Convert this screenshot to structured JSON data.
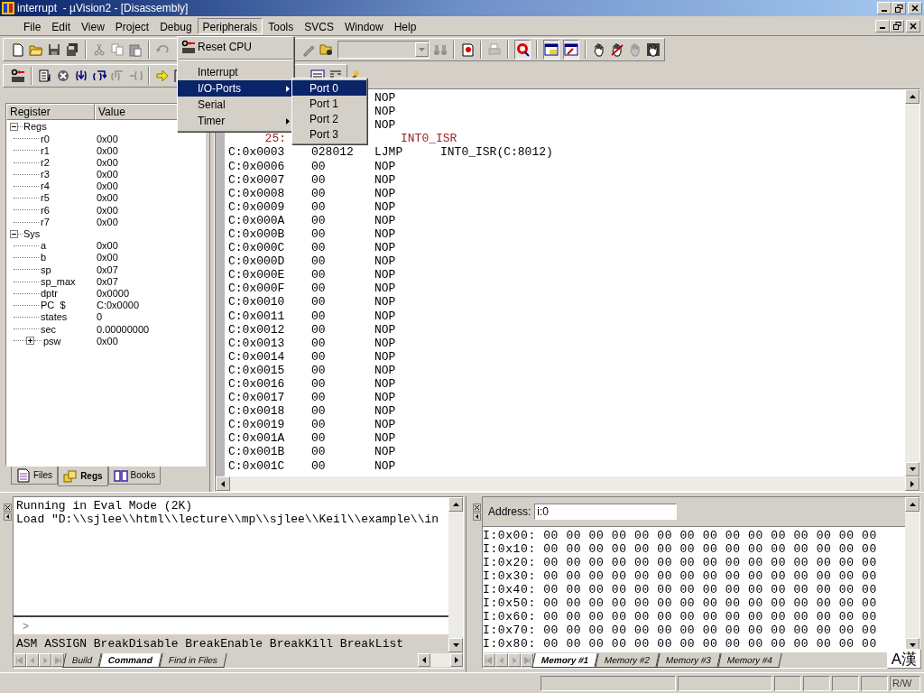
{
  "window": {
    "title": "interrupt  - µVision2 - [Disassembly]"
  },
  "menu_bar": [
    {
      "label": "File",
      "selected": false
    },
    {
      "label": "Edit",
      "selected": false
    },
    {
      "label": "View",
      "selected": false
    },
    {
      "label": "Project",
      "selected": false
    },
    {
      "label": "Debug",
      "selected": false
    },
    {
      "label": "Peripherals",
      "selected": true
    },
    {
      "label": "Tools",
      "selected": false
    },
    {
      "label": "SVCS",
      "selected": false
    },
    {
      "label": "Window",
      "selected": false
    },
    {
      "label": "Help",
      "selected": false
    }
  ],
  "peripherals_menu": {
    "items": [
      {
        "kind": "icon_command",
        "label": "Reset CPU",
        "selected": false
      },
      {
        "kind": "separator"
      },
      {
        "kind": "command",
        "label": "Interrupt",
        "selected": false
      },
      {
        "kind": "submenu",
        "label": "I/O-Ports",
        "selected": true
      },
      {
        "kind": "command",
        "label": "Serial",
        "selected": false
      },
      {
        "kind": "submenu",
        "label": "Timer",
        "selected": false
      }
    ]
  },
  "io_ports_submenu": [
    {
      "label": "Port 0",
      "selected": true
    },
    {
      "label": "Port 1",
      "selected": false
    },
    {
      "label": "Port 2",
      "selected": false
    },
    {
      "label": "Port 3",
      "selected": false
    }
  ],
  "register_panel": {
    "columns": [
      "Register",
      "Value"
    ],
    "tree": [
      {
        "name": "Regs",
        "expanded": true,
        "children": [
          {
            "name": "r0",
            "value": "0x00"
          },
          {
            "name": "r1",
            "value": "0x00"
          },
          {
            "name": "r2",
            "value": "0x00"
          },
          {
            "name": "r3",
            "value": "0x00"
          },
          {
            "name": "r4",
            "value": "0x00"
          },
          {
            "name": "r5",
            "value": "0x00"
          },
          {
            "name": "r6",
            "value": "0x00"
          },
          {
            "name": "r7",
            "value": "0x00"
          }
        ]
      },
      {
        "name": "Sys",
        "expanded": true,
        "children": [
          {
            "name": "a",
            "value": "0x00"
          },
          {
            "name": "b",
            "value": "0x00"
          },
          {
            "name": "sp",
            "value": "0x07"
          },
          {
            "name": "sp_max",
            "value": "0x07"
          },
          {
            "name": "dptr",
            "value": "0x0000"
          },
          {
            "name": "PC  $",
            "value": "C:0x0000"
          },
          {
            "name": "states",
            "value": "0"
          },
          {
            "name": "sec",
            "value": "0.00000000"
          },
          {
            "name": "psw",
            "value": "0x00",
            "expanded": false
          }
        ]
      }
    ],
    "tabs": [
      {
        "label": "Files",
        "selected": false
      },
      {
        "label": "Regs",
        "selected": true
      },
      {
        "label": "Books",
        "selected": false
      }
    ]
  },
  "disassembly": {
    "lines": [
      {
        "kind": "code",
        "mnemonic": "NOP"
      },
      {
        "kind": "code",
        "mnemonic": "NOP"
      },
      {
        "kind": "code",
        "mnemonic": "NOP"
      },
      {
        "kind": "source",
        "line_number": "25:",
        "text": "INT0_ISR"
      },
      {
        "kind": "code",
        "address": "C:0x0003",
        "opcode": "028012",
        "mnemonic": "LJMP",
        "operand": "INT0_ISR(C:8012)"
      },
      {
        "kind": "code",
        "address": "C:0x0006",
        "opcode": "00",
        "mnemonic": "NOP"
      },
      {
        "kind": "code",
        "address": "C:0x0007",
        "opcode": "00",
        "mnemonic": "NOP"
      },
      {
        "kind": "code",
        "address": "C:0x0008",
        "opcode": "00",
        "mnemonic": "NOP"
      },
      {
        "kind": "code",
        "address": "C:0x0009",
        "opcode": "00",
        "mnemonic": "NOP"
      },
      {
        "kind": "code",
        "address": "C:0x000A",
        "opcode": "00",
        "mnemonic": "NOP"
      },
      {
        "kind": "code",
        "address": "C:0x000B",
        "opcode": "00",
        "mnemonic": "NOP"
      },
      {
        "kind": "code",
        "address": "C:0x000C",
        "opcode": "00",
        "mnemonic": "NOP"
      },
      {
        "kind": "code",
        "address": "C:0x000D",
        "opcode": "00",
        "mnemonic": "NOP"
      },
      {
        "kind": "code",
        "address": "C:0x000E",
        "opcode": "00",
        "mnemonic": "NOP"
      },
      {
        "kind": "code",
        "address": "C:0x000F",
        "opcode": "00",
        "mnemonic": "NOP"
      },
      {
        "kind": "code",
        "address": "C:0x0010",
        "opcode": "00",
        "mnemonic": "NOP"
      },
      {
        "kind": "code",
        "address": "C:0x0011",
        "opcode": "00",
        "mnemonic": "NOP"
      },
      {
        "kind": "code",
        "address": "C:0x0012",
        "opcode": "00",
        "mnemonic": "NOP"
      },
      {
        "kind": "code",
        "address": "C:0x0013",
        "opcode": "00",
        "mnemonic": "NOP"
      },
      {
        "kind": "code",
        "address": "C:0x0014",
        "opcode": "00",
        "mnemonic": "NOP"
      },
      {
        "kind": "code",
        "address": "C:0x0015",
        "opcode": "00",
        "mnemonic": "NOP"
      },
      {
        "kind": "code",
        "address": "C:0x0016",
        "opcode": "00",
        "mnemonic": "NOP"
      },
      {
        "kind": "code",
        "address": "C:0x0017",
        "opcode": "00",
        "mnemonic": "NOP"
      },
      {
        "kind": "code",
        "address": "C:0x0018",
        "opcode": "00",
        "mnemonic": "NOP"
      },
      {
        "kind": "code",
        "address": "C:0x0019",
        "opcode": "00",
        "mnemonic": "NOP"
      },
      {
        "kind": "code",
        "address": "C:0x001A",
        "opcode": "00",
        "mnemonic": "NOP"
      },
      {
        "kind": "code",
        "address": "C:0x001B",
        "opcode": "00",
        "mnemonic": "NOP"
      },
      {
        "kind": "code",
        "address": "C:0x001C",
        "opcode": "00",
        "mnemonic": "NOP"
      }
    ]
  },
  "output": {
    "lines": [
      "Running in Eval Mode (2K)",
      "Load \"D:\\\\sjlee\\\\html\\\\lecture\\\\mp\\\\sjlee\\\\Keil\\\\example\\\\in"
    ],
    "prompt": ">",
    "hint": "ASM ASSIGN BreakDisable BreakEnable BreakKill BreakList",
    "tabs": [
      {
        "label": "Build",
        "selected": false
      },
      {
        "label": "Command",
        "selected": true
      },
      {
        "label": "Find in Files",
        "selected": false
      }
    ]
  },
  "memory": {
    "address_label": "Address:",
    "address_value": "i:0",
    "rows": [
      "I:0x00: 00 00 00 00 00 00 00 00 00 00 00 00 00 00 00",
      "I:0x10: 00 00 00 00 00 00 00 00 00 00 00 00 00 00 00",
      "I:0x20: 00 00 00 00 00 00 00 00 00 00 00 00 00 00 00",
      "I:0x30: 00 00 00 00 00 00 00 00 00 00 00 00 00 00 00",
      "I:0x40: 00 00 00 00 00 00 00 00 00 00 00 00 00 00 00",
      "I:0x50: 00 00 00 00 00 00 00 00 00 00 00 00 00 00 00",
      "I:0x60: 00 00 00 00 00 00 00 00 00 00 00 00 00 00 00",
      "I:0x70: 00 00 00 00 00 00 00 00 00 00 00 00 00 00 00",
      "I:0x80: 00 00 00 00 00 00 00 00 00 00 00 00 00 00 00"
    ],
    "tabs": [
      {
        "label": "Memory #1",
        "selected": true
      },
      {
        "label": "Memory #2",
        "selected": false
      },
      {
        "label": "Memory #3",
        "selected": false
      },
      {
        "label": "Memory #4",
        "selected": false
      }
    ]
  },
  "ime_indicator": "A漢",
  "status_bar": {
    "mode": "R/W"
  }
}
